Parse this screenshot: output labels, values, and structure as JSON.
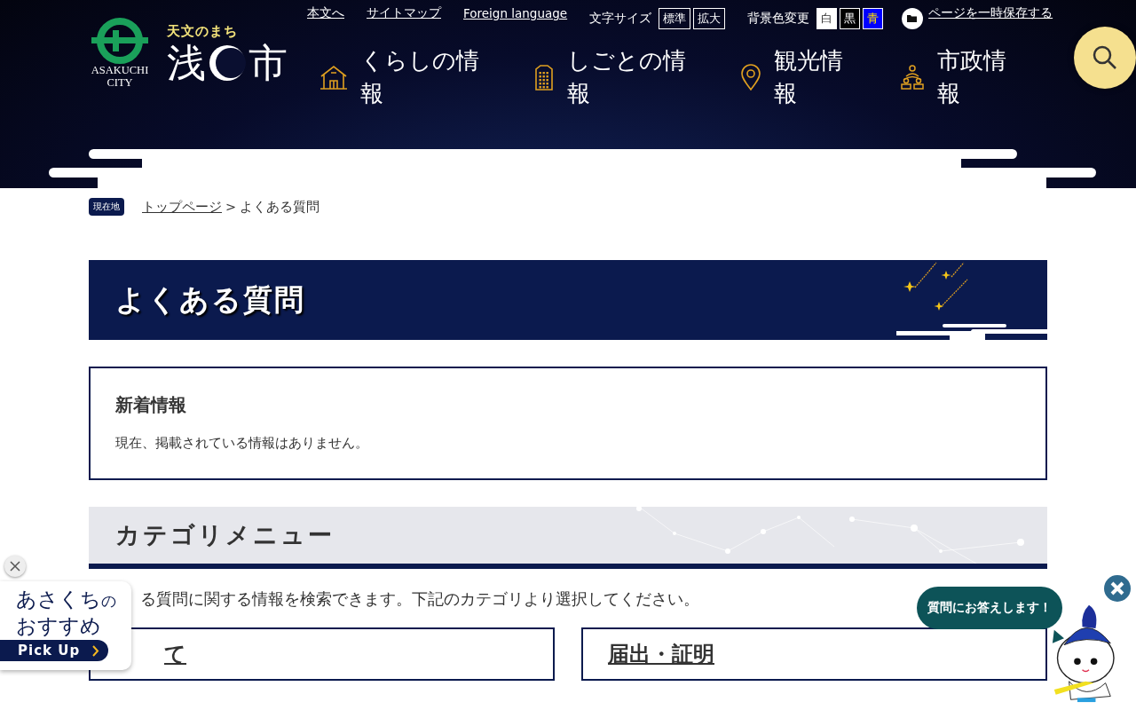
{
  "header": {
    "logo": {
      "tagline": "天文のまち",
      "city_name_left": "浅",
      "city_name_right": "市",
      "english_line1": "ASAKUCHI",
      "english_line2": "CITY"
    },
    "utility_links": [
      "本文へ",
      "サイトマップ",
      "Foreign language"
    ],
    "font_size": {
      "label": "文字サイズ",
      "buttons": [
        "標準",
        "拡大"
      ]
    },
    "bg_color": {
      "label": "背景色変更",
      "buttons": [
        {
          "label": "白",
          "kind": "white"
        },
        {
          "label": "黒",
          "kind": "black"
        },
        {
          "label": "青",
          "kind": "blue"
        }
      ]
    },
    "save_link": "ページを一時保存する",
    "nav": [
      {
        "label": "くらしの情報",
        "kind": "house"
      },
      {
        "label": "しごとの情報",
        "kind": "building"
      },
      {
        "label": "観光情報",
        "kind": "pin"
      },
      {
        "label": "市政情報",
        "kind": "people"
      }
    ]
  },
  "breadcrumb": {
    "badge": "現在地",
    "links": [
      "トップページ"
    ],
    "separator": ">",
    "current": "よくある質問"
  },
  "page_title": "よくある質問",
  "news": {
    "heading": "新着情報",
    "text": "現在、掲載されている情報はありません。"
  },
  "category_menu": {
    "heading": "カテゴリメニュー",
    "description": "る質問に関する情報を検索できます。下記のカテゴリより選択してください。",
    "items": [
      "て",
      "届出・証明"
    ]
  },
  "pickup": {
    "title_main": "あさくち",
    "title_suffix": "の",
    "title_line2": "おすすめ",
    "button": "Pick Up"
  },
  "mascot": {
    "bubble": "質問にお答えします！"
  }
}
